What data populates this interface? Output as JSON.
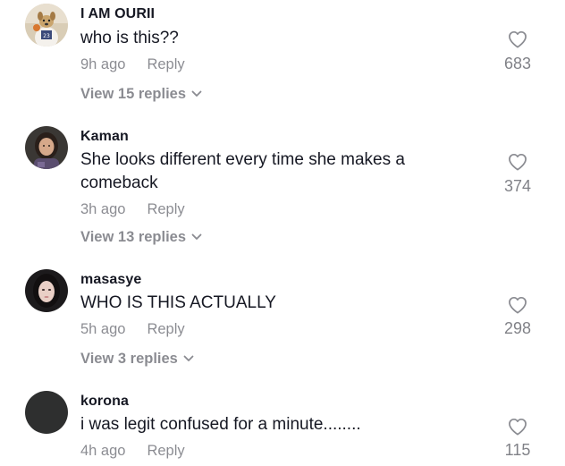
{
  "comments": [
    {
      "username": "I AM OURII",
      "text": "who is this??",
      "time": "9h ago",
      "reply_label": "Reply",
      "view_replies": "View 15 replies",
      "likes": "683",
      "avatar_icon": "dog-basketball-avatar"
    },
    {
      "username": "Kaman",
      "text": "She looks different every time she makes a comeback",
      "time": "3h ago",
      "reply_label": "Reply",
      "view_replies": "View 13 replies",
      "likes": "374",
      "avatar_icon": "person-photo-avatar"
    },
    {
      "username": "masasye",
      "text": "WHO IS THIS ACTUALLY",
      "time": "5h ago",
      "reply_label": "Reply",
      "view_replies": "View 3 replies",
      "likes": "298",
      "avatar_icon": "person-photo-avatar"
    },
    {
      "username": "korona",
      "text": "i was legit confused for a minute........",
      "time": "4h ago",
      "reply_label": "Reply",
      "likes": "115",
      "avatar_icon": "dark-circle-avatar"
    }
  ],
  "colors": {
    "text_primary": "#161823",
    "text_secondary": "#8a8b91",
    "icon_gray": "#8a8b91"
  },
  "icons": {
    "like": "heart-outline-icon",
    "expand": "chevron-down-icon"
  }
}
